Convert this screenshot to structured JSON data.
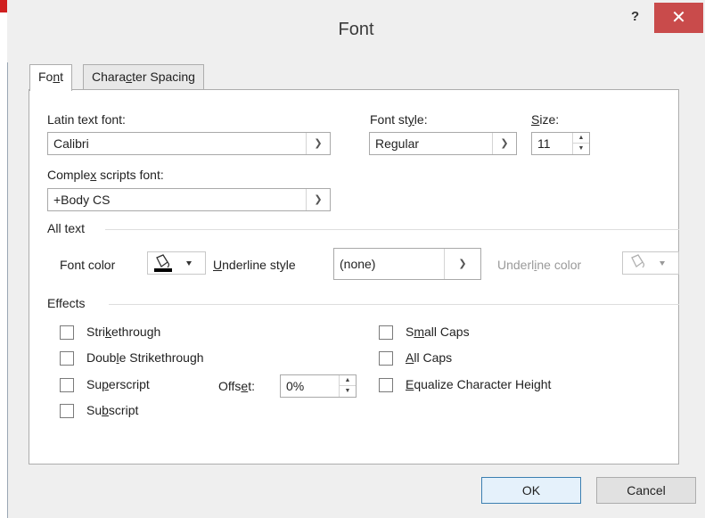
{
  "window": {
    "title": "Font",
    "help": "?",
    "close": "✕"
  },
  "tabs": [
    {
      "label_pre": "Fo",
      "label_u": "n",
      "label_post": "t"
    },
    {
      "label_pre": "Chara",
      "label_u": "c",
      "label_post": "ter Spacing"
    }
  ],
  "fonts": {
    "latin_label": "Latin text font:",
    "latin_value": "Calibri",
    "style_label_pre": "Font st",
    "style_label_u": "y",
    "style_label_post": "le:",
    "style_value": "Regular",
    "size_label_u": "S",
    "size_label_post": "ize:",
    "size_value": "11",
    "complex_label_pre": "Comple",
    "complex_label_u": "x",
    "complex_label_post": " scripts font:",
    "complex_value": "+Body CS"
  },
  "all_text": {
    "heading": "All text",
    "font_color_label": "Font color",
    "underline_style_label_u": "U",
    "underline_style_label_post": "nderline style",
    "underline_style_value": "(none)",
    "underline_color_label_pre": "Underl",
    "underline_color_label_u": "i",
    "underline_color_label_post": "ne color",
    "font_color_hex": "#000000"
  },
  "effects": {
    "heading": "Effects",
    "strike_pre": "Stri",
    "strike_u": "k",
    "strike_post": "ethrough",
    "dstrike_pre": "Doub",
    "dstrike_u": "l",
    "dstrike_post": "e Strikethrough",
    "super_pre": "Su",
    "super_u": "p",
    "super_post": "erscript",
    "sub_pre": "Su",
    "sub_u": "b",
    "sub_post": "script",
    "offset_pre": "Offs",
    "offset_u": "e",
    "offset_post": "t:",
    "offset_value": "0%",
    "smallcaps_pre": "S",
    "smallcaps_u": "m",
    "smallcaps_post": "all Caps",
    "allcaps_u": "A",
    "allcaps_post": "ll Caps",
    "equalize_u": "E",
    "equalize_post": "qualize Character Height"
  },
  "buttons": {
    "ok": "OK",
    "cancel": "Cancel"
  }
}
